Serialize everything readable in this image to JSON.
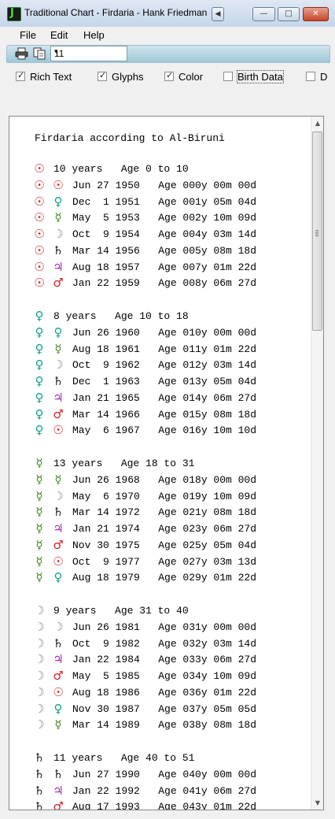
{
  "window": {
    "title": "Traditional Chart - Firdaria - Hank Friedman",
    "controls": {
      "minimize": "—",
      "maximize": "□",
      "close": "✕",
      "system": "◀"
    }
  },
  "menu": [
    "File",
    "Edit",
    "Help"
  ],
  "toolbar": {
    "icons": [
      "printer-icon",
      "copy-icon"
    ],
    "zoom_value": "11",
    "zoom_arrow": "▾"
  },
  "options": [
    {
      "label": "Rich Text",
      "checked": true
    },
    {
      "label": "Glyphs",
      "checked": true
    },
    {
      "label": "Color",
      "checked": true
    },
    {
      "label": "Birth Data",
      "checked": false
    },
    {
      "label": "D",
      "checked": false
    }
  ],
  "colors": {
    "sun": "#d42020",
    "venus": "#12a28a",
    "mercury": "#3e8a1e",
    "moon": "#8a8a8a",
    "saturn": "#1a1a1a",
    "jupiter": "#a02bb2",
    "mars": "#d42020"
  },
  "glyphs": {
    "sun": "☉",
    "venus": "♀",
    "mercury": "☿",
    "moon": "☽",
    "saturn": "♄",
    "jupiter": "♃",
    "mars": "♂"
  },
  "content": {
    "heading": "Firdaria according to Al-Biruni",
    "sections": [
      {
        "planet": "sun",
        "header": "10 years   Age 0 to 10",
        "rows": [
          {
            "sub": "sun",
            "text": "Jun 27 1950   Age 000y 00m 00d"
          },
          {
            "sub": "venus",
            "text": "Dec  1 1951   Age 001y 05m 04d"
          },
          {
            "sub": "mercury",
            "text": "May  5 1953   Age 002y 10m 09d"
          },
          {
            "sub": "moon",
            "text": "Oct  9 1954   Age 004y 03m 14d"
          },
          {
            "sub": "saturn",
            "text": "Mar 14 1956   Age 005y 08m 18d"
          },
          {
            "sub": "jupiter",
            "text": "Aug 18 1957   Age 007y 01m 22d"
          },
          {
            "sub": "mars",
            "text": "Jan 22 1959   Age 008y 06m 27d"
          }
        ]
      },
      {
        "planet": "venus",
        "header": "8 years   Age 10 to 18",
        "rows": [
          {
            "sub": "venus",
            "text": "Jun 26 1960   Age 010y 00m 00d"
          },
          {
            "sub": "mercury",
            "text": "Aug 18 1961   Age 011y 01m 22d"
          },
          {
            "sub": "moon",
            "text": "Oct  9 1962   Age 012y 03m 14d"
          },
          {
            "sub": "saturn",
            "text": "Dec  1 1963   Age 013y 05m 04d"
          },
          {
            "sub": "jupiter",
            "text": "Jan 21 1965   Age 014y 06m 27d"
          },
          {
            "sub": "mars",
            "text": "Mar 14 1966   Age 015y 08m 18d"
          },
          {
            "sub": "sun",
            "text": "May  6 1967   Age 016y 10m 10d"
          }
        ]
      },
      {
        "planet": "mercury",
        "header": "13 years   Age 18 to 31",
        "rows": [
          {
            "sub": "mercury",
            "text": "Jun 26 1968   Age 018y 00m 00d"
          },
          {
            "sub": "moon",
            "text": "May  6 1970   Age 019y 10m 09d"
          },
          {
            "sub": "saturn",
            "text": "Mar 14 1972   Age 021y 08m 18d"
          },
          {
            "sub": "jupiter",
            "text": "Jan 21 1974   Age 023y 06m 27d"
          },
          {
            "sub": "mars",
            "text": "Nov 30 1975   Age 025y 05m 04d"
          },
          {
            "sub": "sun",
            "text": "Oct  9 1977   Age 027y 03m 13d"
          },
          {
            "sub": "venus",
            "text": "Aug 18 1979   Age 029y 01m 22d"
          }
        ]
      },
      {
        "planet": "moon",
        "header": "9 years   Age 31 to 40",
        "rows": [
          {
            "sub": "moon",
            "text": "Jun 26 1981   Age 031y 00m 00d"
          },
          {
            "sub": "saturn",
            "text": "Oct  9 1982   Age 032y 03m 14d"
          },
          {
            "sub": "jupiter",
            "text": "Jan 22 1984   Age 033y 06m 27d"
          },
          {
            "sub": "mars",
            "text": "May  5 1985   Age 034y 10m 09d"
          },
          {
            "sub": "sun",
            "text": "Aug 18 1986   Age 036y 01m 22d"
          },
          {
            "sub": "venus",
            "text": "Nov 30 1987   Age 037y 05m 05d"
          },
          {
            "sub": "mercury",
            "text": "Mar 14 1989   Age 038y 08m 18d"
          }
        ]
      },
      {
        "planet": "saturn",
        "header": "11 years   Age 40 to 51",
        "rows": [
          {
            "sub": "saturn",
            "text": "Jun 27 1990   Age 040y 00m 00d"
          },
          {
            "sub": "jupiter",
            "text": "Jan 22 1992   Age 041y 06m 27d"
          },
          {
            "sub": "mars",
            "text": "Aug 17 1993   Age 043y 01m 22d"
          }
        ]
      }
    ]
  }
}
